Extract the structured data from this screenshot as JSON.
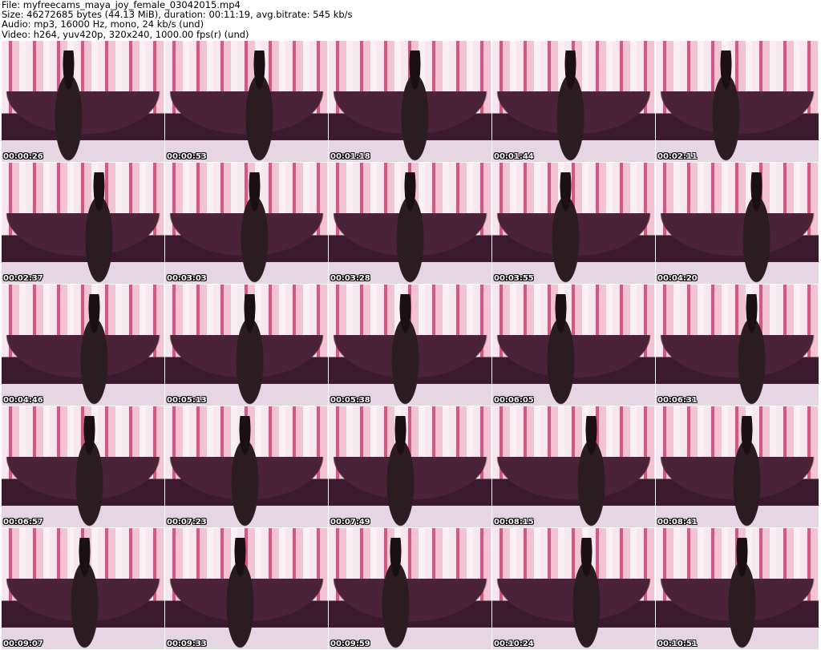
{
  "header": {
    "file": "File: myfreecams_maya_joy_female_03042015.mp4",
    "size": "Size: 46272685 bytes (44.13 MiB), duration: 00:11:19, avg.bitrate: 545 kb/s",
    "audio": "Audio: mp3, 16000 Hz, mono, 24 kb/s (und)",
    "video": "Video: h264, yuv420p, 320x240, 1000.00 fps(r) (und)"
  },
  "thumbnails": [
    "00:00:26",
    "00:00:53",
    "00:01:18",
    "00:01:44",
    "00:02:11",
    "00:02:37",
    "00:03:03",
    "00:03:28",
    "00:03:55",
    "00:04:20",
    "00:04:46",
    "00:05:13",
    "00:05:38",
    "00:06:05",
    "00:06:31",
    "00:06:57",
    "00:07:23",
    "00:07:49",
    "00:08:15",
    "00:08:41",
    "00:09:07",
    "00:09:33",
    "00:09:59",
    "00:10:24",
    "00:10:51"
  ]
}
